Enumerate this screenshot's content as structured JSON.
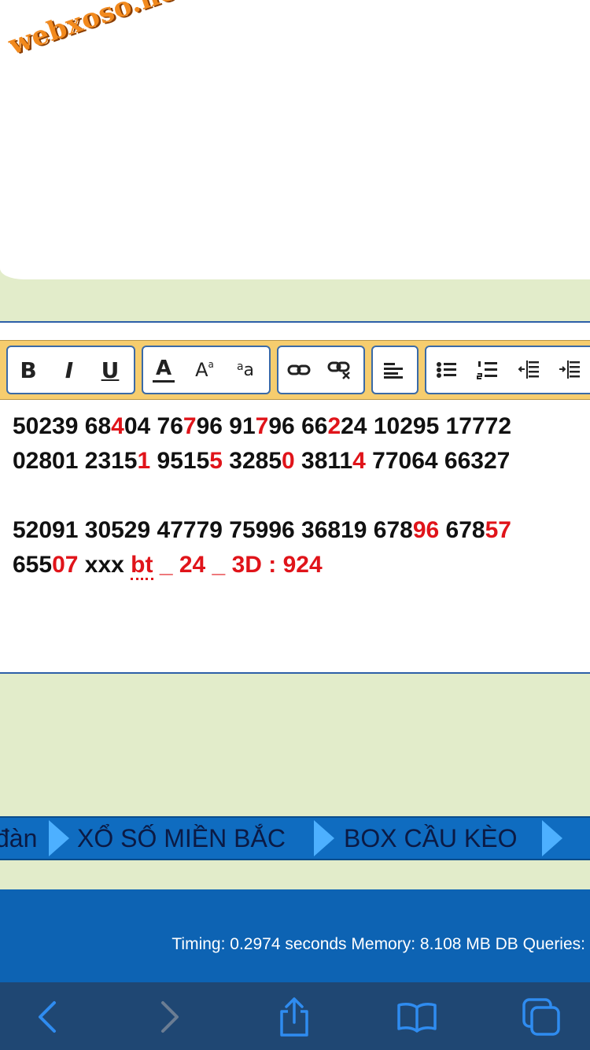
{
  "logo": {
    "text": "webxoso.net"
  },
  "toolbar": {
    "bold": "B",
    "italic": "I",
    "underline": "U",
    "font_color": "A",
    "font_size": "A",
    "font_size_sub": "a",
    "font_family": "a",
    "font_family_sub": "a"
  },
  "content": {
    "line1": [
      {
        "t": "50239 68",
        "r": false
      },
      {
        "t": "4",
        "r": true
      },
      {
        "t": "04 76",
        "r": false
      },
      {
        "t": "7",
        "r": true
      },
      {
        "t": "96 91",
        "r": false
      },
      {
        "t": "7",
        "r": true
      },
      {
        "t": "96 66",
        "r": false
      },
      {
        "t": "2",
        "r": true
      },
      {
        "t": "24 10295 17772",
        "r": false
      }
    ],
    "line2": [
      {
        "t": "02801 2315",
        "r": false
      },
      {
        "t": "1",
        "r": true
      },
      {
        "t": " 9515",
        "r": false
      },
      {
        "t": "5",
        "r": true
      },
      {
        "t": " 3285",
        "r": false
      },
      {
        "t": "0",
        "r": true
      },
      {
        "t": " 3811",
        "r": false
      },
      {
        "t": "4",
        "r": true
      },
      {
        "t": " 77064 66327",
        "r": false
      }
    ],
    "line3": [
      {
        "t": "52091 30529 47779 75996 36819 678",
        "r": false
      },
      {
        "t": "96",
        "r": true
      },
      {
        "t": " 678",
        "r": false
      },
      {
        "t": "57",
        "r": true
      }
    ],
    "line4": [
      {
        "t": "655",
        "r": false
      },
      {
        "t": "07",
        "r": true
      },
      {
        "t": " xxx ",
        "r": false
      },
      {
        "t": "bt",
        "r": true,
        "spell": true
      },
      {
        "t": " _ 24 _ 3D : 924",
        "r": true
      }
    ]
  },
  "nav": {
    "item_partial": "đàn",
    "item_xsmb": "XỔ SỐ MIỀN BẮC",
    "item_box": "BOX CẦU KÈO"
  },
  "footer": {
    "timing": "Timing: 0.2974 seconds Memory: 8.108 MB DB Queries:"
  },
  "colors": {
    "accent_red": "#e0141a",
    "nav_blue": "#0f6cc0",
    "page_bg": "#e2ecca",
    "toolbar_bg": "#f6cd6e"
  }
}
